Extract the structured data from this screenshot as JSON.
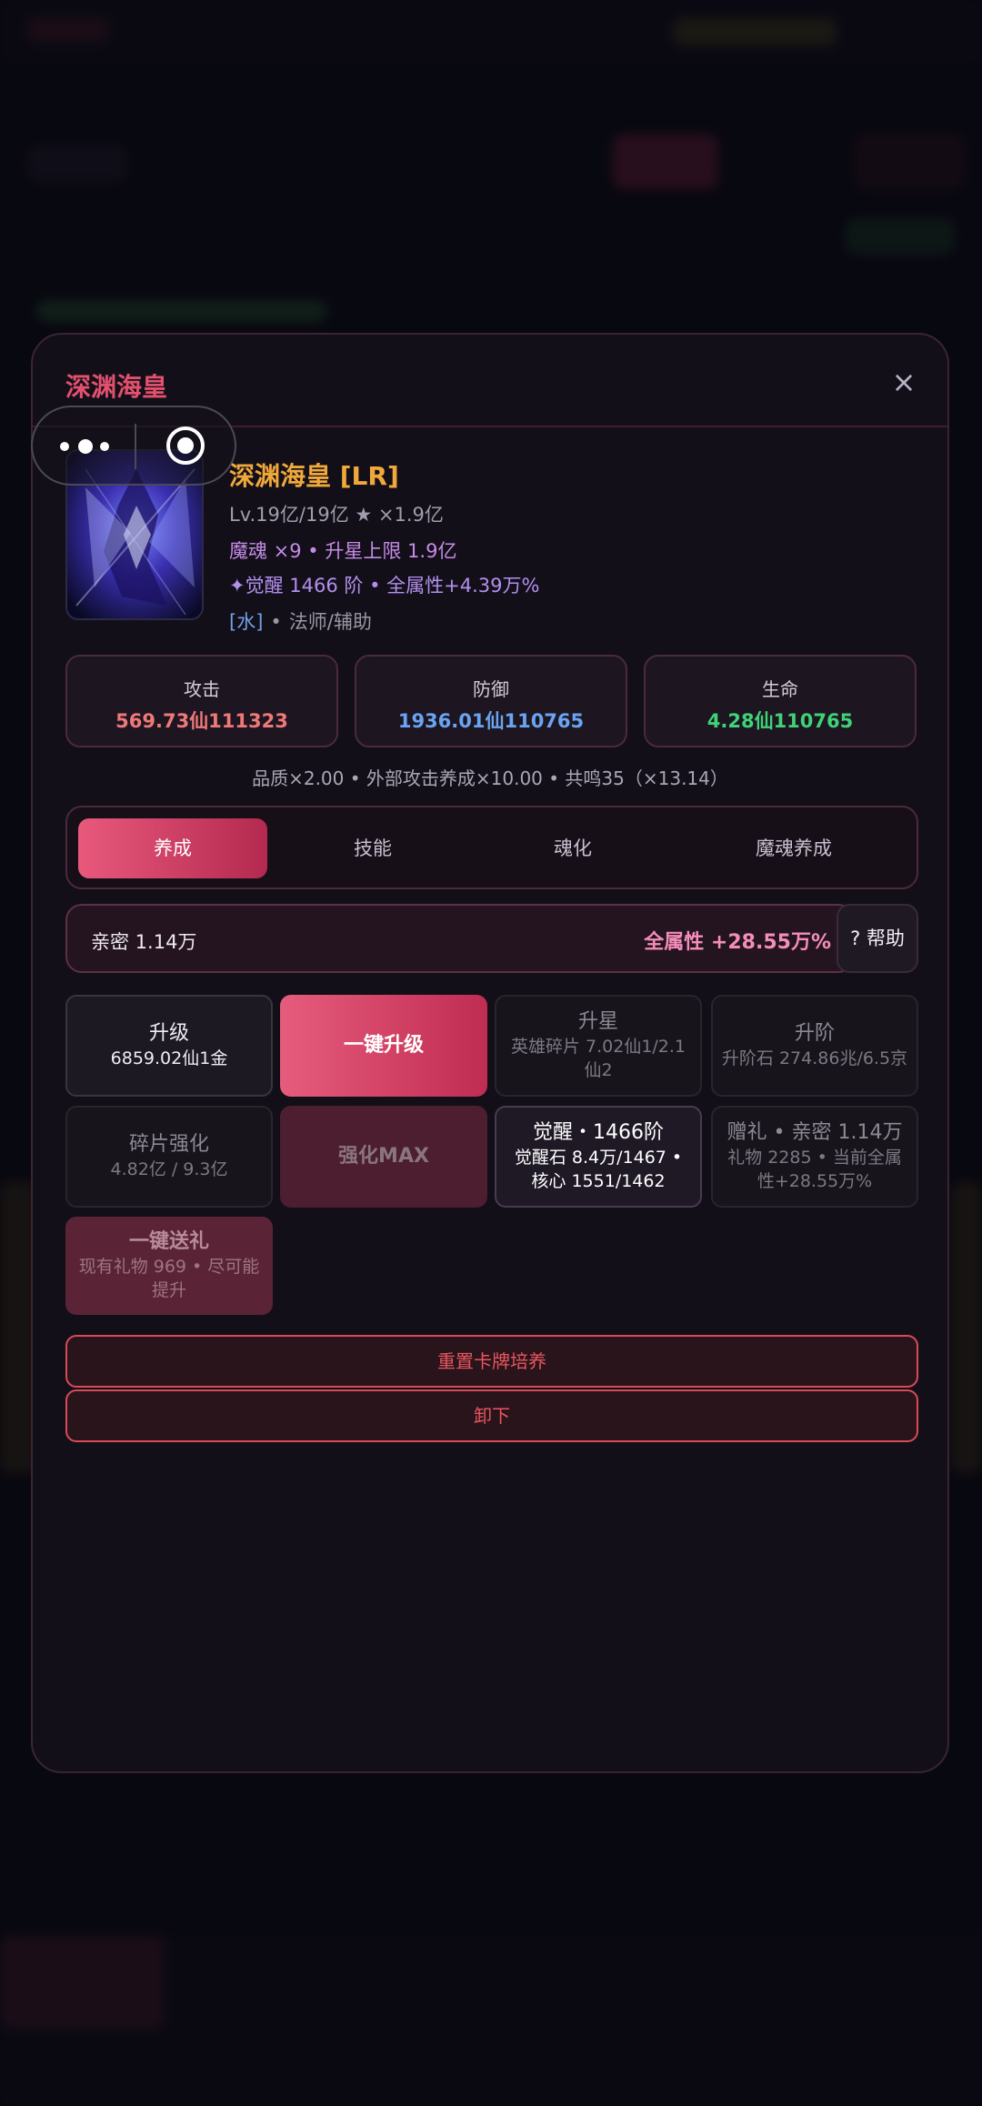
{
  "modal": {
    "title": "深渊海皇",
    "close_label": "×"
  },
  "hero": {
    "name": "深渊海皇 [LR]",
    "level_line": "Lv.19亿/19亿 ★ ×1.9亿",
    "soul_line": "魔魂 ×9 • 升星上限 1.9亿",
    "awaken_line": "✦觉醒 1466 阶 • 全属性+4.39万%",
    "element": "[水]",
    "role": "法师/辅助"
  },
  "stats": [
    {
      "label": "攻击",
      "value": "569.73仙111323",
      "color": "#f07878"
    },
    {
      "label": "防御",
      "value": "1936.01仙110765",
      "color": "#6aa4f2"
    },
    {
      "label": "生命",
      "value": "4.28仙110765",
      "color": "#3fd277"
    }
  ],
  "quality_line": "品质×2.00 • 外部攻击养成×10.00 • 共鸣35（×13.14）",
  "tabs": [
    "养成",
    "技能",
    "魂化",
    "魔魂养成"
  ],
  "active_tab": "养成",
  "intimacy": {
    "left": "亲密 1.14万",
    "right": "全属性 +28.55万%"
  },
  "help_label": "? 帮助",
  "actions": {
    "upgrade": {
      "title": "升级",
      "sub": "6859.02仙1金"
    },
    "one_click_upgrade": {
      "title": "一键升级"
    },
    "star_up": {
      "title": "升星",
      "sub": "英雄碎片 7.02仙1/2.1仙2"
    },
    "rank_up": {
      "title": "升阶",
      "sub": "升阶石 274.86兆/6.5京"
    },
    "shard_enhance": {
      "title": "碎片强化",
      "sub": "4.82亿 / 9.3亿"
    },
    "enhance_max": {
      "title": "强化MAX"
    },
    "awaken": {
      "title": "觉醒・1466阶",
      "sub": "觉醒石 8.4万/1467 • 核心 1551/1462"
    },
    "gift_info": {
      "title": "赠礼 • 亲密 1.14万",
      "sub": "礼物 2285 • 当前全属性+28.55万%"
    },
    "one_click_gift": {
      "title": "一键送礼",
      "sub": "现有礼物 969 • 尽可能提升"
    }
  },
  "buttons": {
    "reset": "重置卡牌培养",
    "unequip": "卸下"
  },
  "colors": {
    "accent": "#e2506e",
    "gold": "#f0a83a",
    "danger": "#e8565f"
  },
  "icons": [
    "more-dots-icon",
    "target-icon",
    "close-icon"
  ]
}
